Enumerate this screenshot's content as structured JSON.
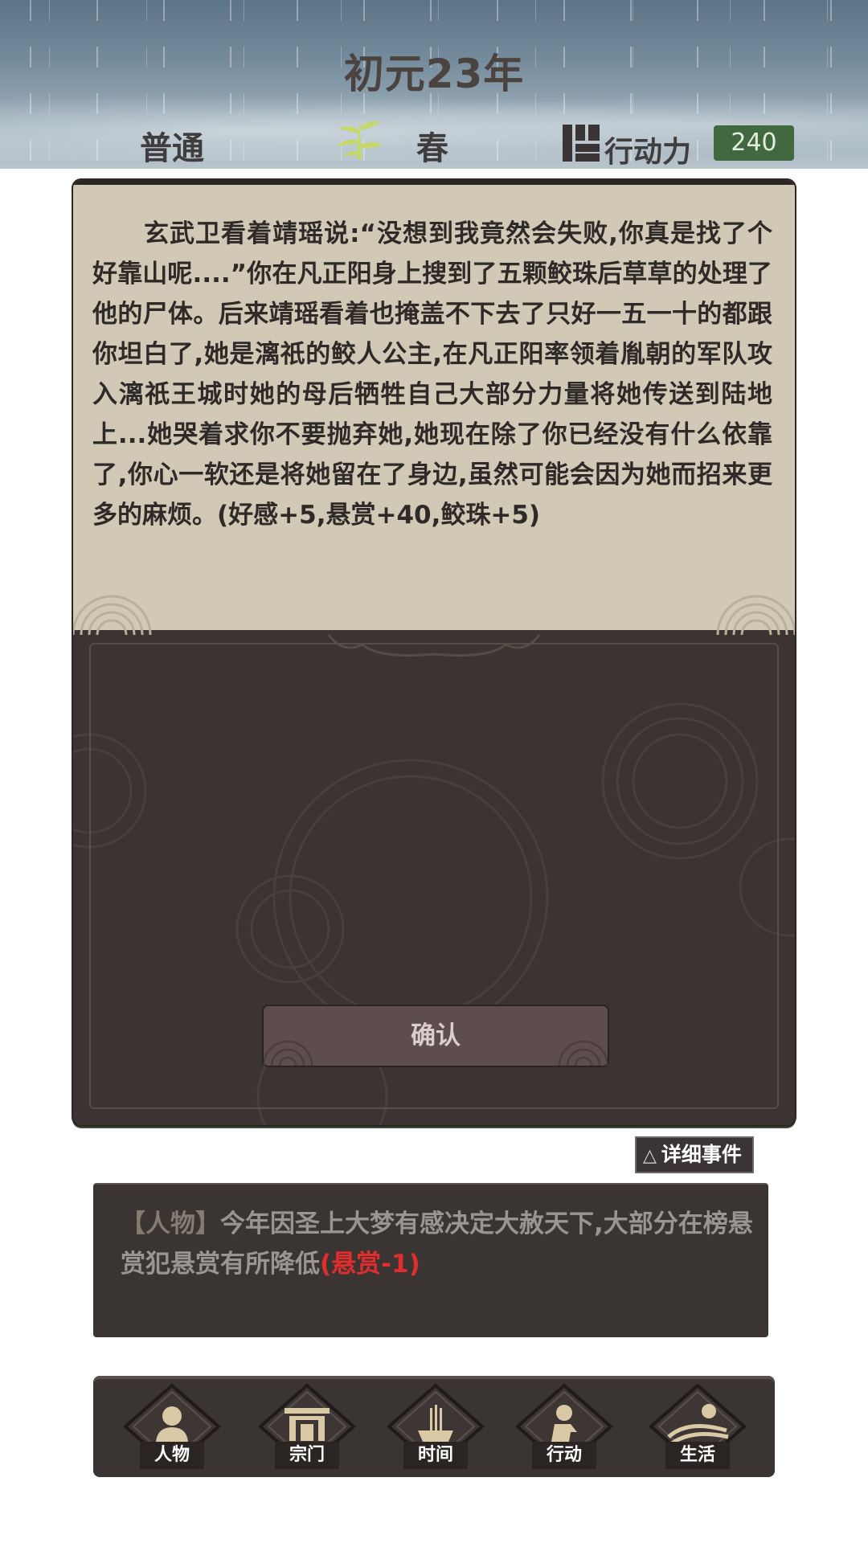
{
  "header": {
    "year": "初元23年",
    "difficulty": "普通",
    "season": "春",
    "action_points_label": "行动力",
    "action_points_value": "240"
  },
  "event": {
    "text": "玄武卫看着靖瑶说:“没想到我竟然会失败,你真是找了个好靠山呢....”你在凡正阳身上搜到了五颗鲛珠后草草的处理了他的尸体。后来靖瑶看着也掩盖不下去了只好一五一十的都跟你坦白了,她是漓祇的鲛人公主,在凡正阳率领着胤朝的军队攻入漓祇王城时她的母后牺牲自己大部分力量将她传送到陆地上...她哭着求你不要抛弃她,她现在除了你已经没有什么依靠了,你心一软还是将她留在了身边,虽然可能会因为她而招来更多的麻烦。(好感+5,悬赏+40,鲛珠+5)",
    "confirm_label": "确认"
  },
  "detail": {
    "toggle_symbol": "△",
    "toggle_label": "详细事件",
    "log_tag": "【人物】",
    "log_text": "今年因圣上大梦有感决定大赦天下,大部分在榜悬赏犯悬赏有所降低",
    "log_penalty": "(悬赏-1)"
  },
  "nav": {
    "items": [
      {
        "label": "人物",
        "icon": "person-icon"
      },
      {
        "label": "宗门",
        "icon": "sect-gate-icon"
      },
      {
        "label": "时间",
        "icon": "incense-icon"
      },
      {
        "label": "行动",
        "icon": "action-icon"
      },
      {
        "label": "生活",
        "icon": "landscape-icon"
      }
    ]
  },
  "colors": {
    "panel_dark": "#3b3433",
    "paper": "#d1c9b6",
    "action_points_bg": "#42683f",
    "penalty_red": "#e02d2d",
    "icon_gold": "#d9c9a4"
  }
}
